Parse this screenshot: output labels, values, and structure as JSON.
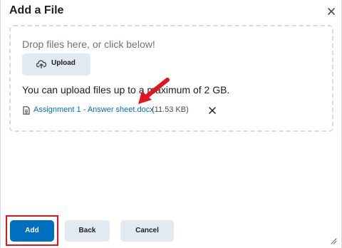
{
  "dialog": {
    "title": "Add a File",
    "close_icon": "close-icon"
  },
  "dropzone": {
    "prompt": "Drop files here, or click below!",
    "upload_label": "Upload",
    "upload_icon": "cloud-upload-icon",
    "limit_text": "You can upload files up to a maximum of 2 GB."
  },
  "file": {
    "icon": "document-icon",
    "name": "Assignment 1 - Answer sheet.docx",
    "size": "(11.53 KB)",
    "remove_icon": "close-icon"
  },
  "footer": {
    "add_label": "Add",
    "back_label": "Back",
    "cancel_label": "Cancel"
  },
  "colors": {
    "primary": "#006fbf",
    "secondary_button": "#e3e9f1",
    "annotation": "#e5131d",
    "link": "#006fbf"
  }
}
